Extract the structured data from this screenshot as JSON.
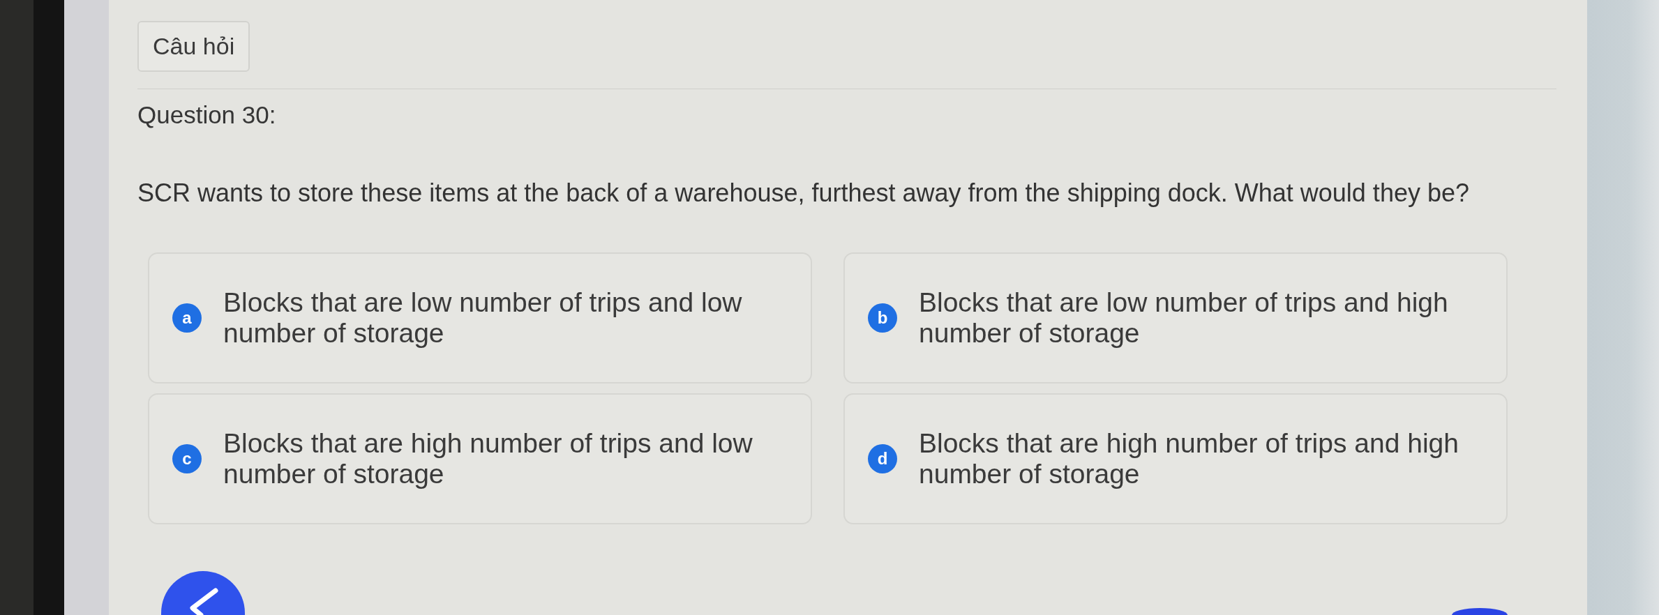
{
  "header": {
    "questions_button": "Câu hỏi"
  },
  "question": {
    "number_label": "Question 30:",
    "text": "SCR wants to store these items at the back of a warehouse, furthest away from the shipping dock. What would they be?"
  },
  "options": [
    {
      "letter": "a",
      "text": "Blocks that are low number of trips and low number of storage",
      "selected": false
    },
    {
      "letter": "b",
      "text": "Blocks that are low number of trips and high number of storage",
      "selected": false
    },
    {
      "letter": "c",
      "text": "Blocks that are high number of trips and low number of storage",
      "selected": false
    },
    {
      "letter": "d",
      "text": "Blocks that are high number of trips and high number of storage",
      "selected": false
    }
  ]
}
